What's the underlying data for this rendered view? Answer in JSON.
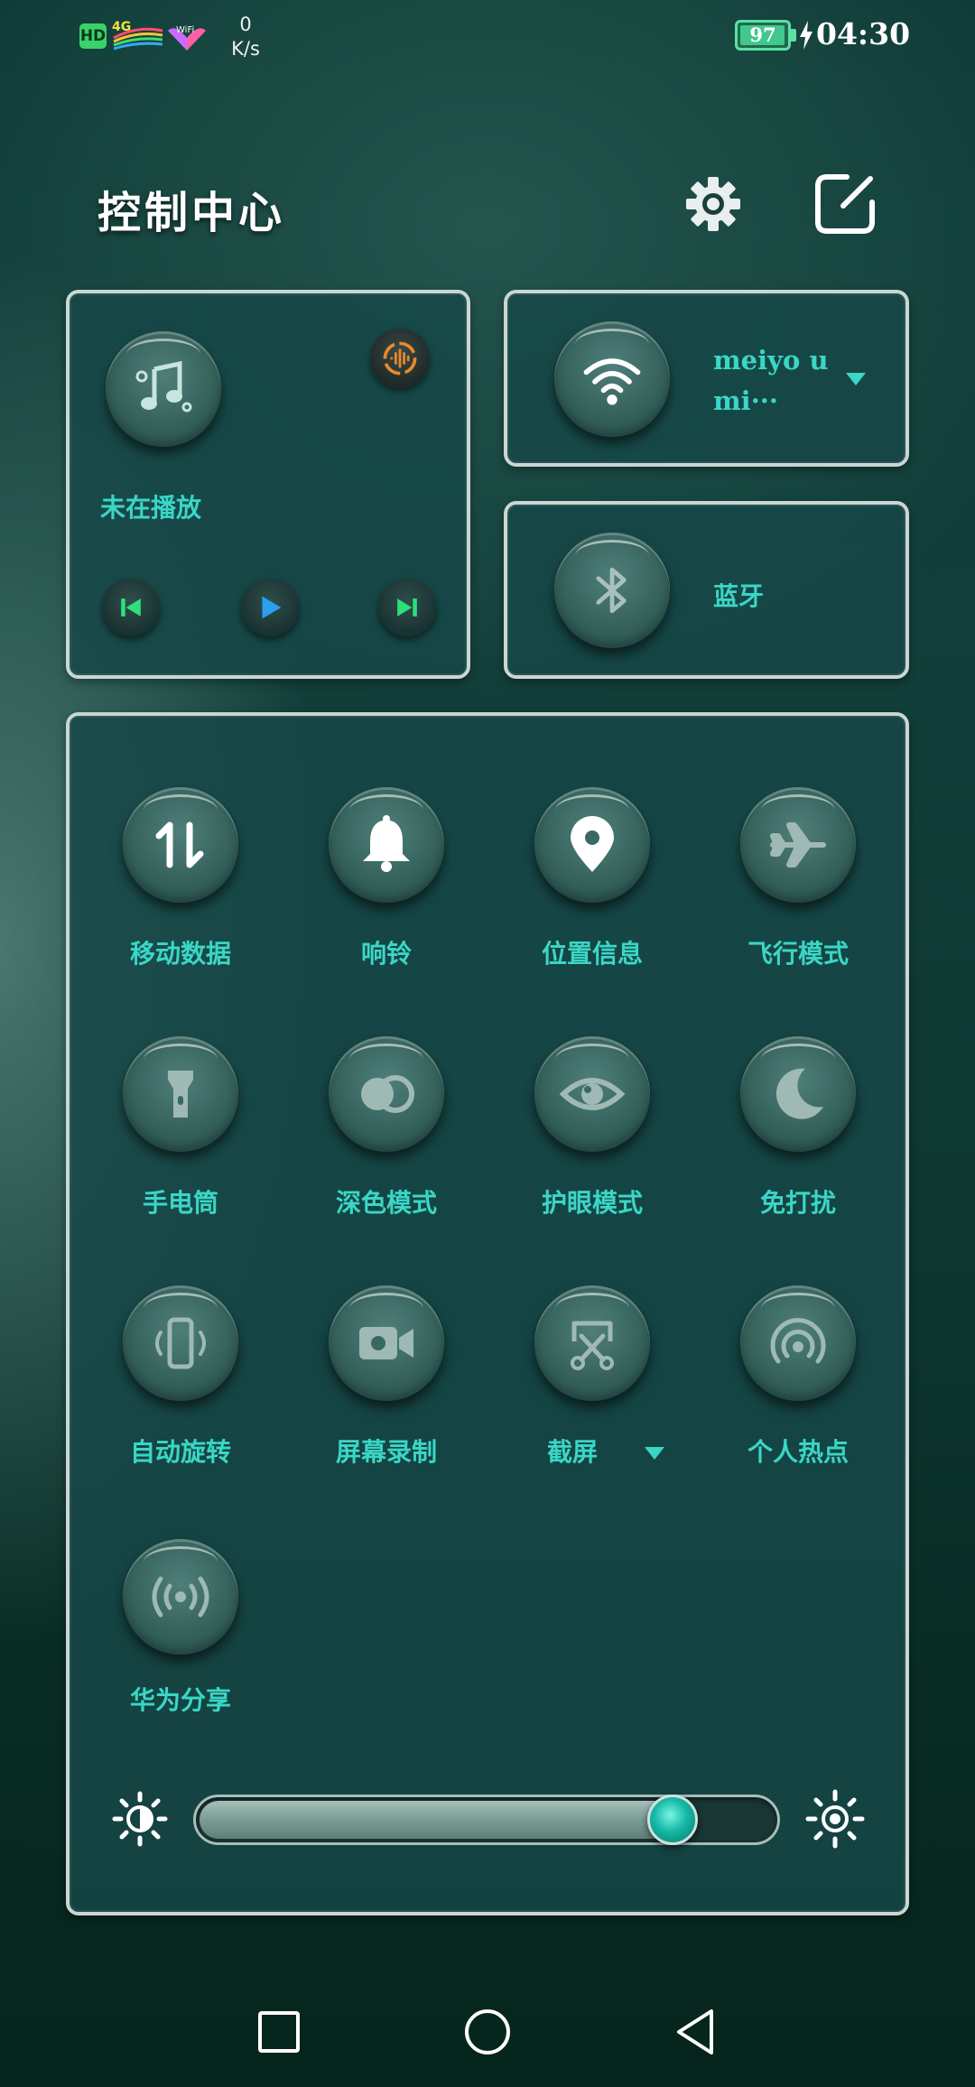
{
  "status_bar": {
    "hd_badge": "HD",
    "network_type": "4G",
    "wifi_badge": "WiFi",
    "net_speed_value": "0",
    "net_speed_unit": "K/s",
    "battery_level": 97,
    "battery_text": "97",
    "charging": true,
    "time": "04:30"
  },
  "header": {
    "title": "控制中心",
    "settings_icon": "gear-icon",
    "edit_icon": "edit-icon"
  },
  "media": {
    "status": "未在播放",
    "icon": "music-note-icon",
    "audio_icon": "audio-wave-icon",
    "controls": [
      "skip-previous-icon",
      "play-icon",
      "skip-next-icon"
    ]
  },
  "wifi": {
    "network_name": "meiyo umi···",
    "icon": "wifi-icon"
  },
  "bluetooth": {
    "label": "蓝牙",
    "icon": "bluetooth-icon"
  },
  "tiles": [
    {
      "label": "移动数据",
      "icon": "mobile-data-icon"
    },
    {
      "label": "响铃",
      "icon": "bell-icon"
    },
    {
      "label": "位置信息",
      "icon": "location-pin-icon"
    },
    {
      "label": "飞行模式",
      "icon": "airplane-icon"
    },
    {
      "label": "手电筒",
      "icon": "flashlight-icon"
    },
    {
      "label": "深色模式",
      "icon": "dark-mode-icon"
    },
    {
      "label": "护眼模式",
      "icon": "eye-icon"
    },
    {
      "label": "免打扰",
      "icon": "moon-icon"
    },
    {
      "label": "自动旋转",
      "icon": "auto-rotate-icon"
    },
    {
      "label": "屏幕录制",
      "icon": "video-camera-icon"
    },
    {
      "label": "截屏",
      "icon": "screenshot-scissors-icon",
      "has_dropdown": true
    },
    {
      "label": "个人热点",
      "icon": "hotspot-icon"
    },
    {
      "label": "华为分享",
      "icon": "huawei-share-icon"
    }
  ],
  "brightness": {
    "level": 0.83,
    "min_icon": "brightness-low-icon",
    "max_icon": "brightness-high-icon"
  },
  "nav_bar": [
    "recents-square-icon",
    "home-circle-icon",
    "back-triangle-icon"
  ],
  "colors": {
    "accent": "#3ad6c6",
    "panel_border": "#c9d6d3",
    "panel_bg": "#164848",
    "thumb": "#14b8a5",
    "battery": "#42c88c"
  }
}
